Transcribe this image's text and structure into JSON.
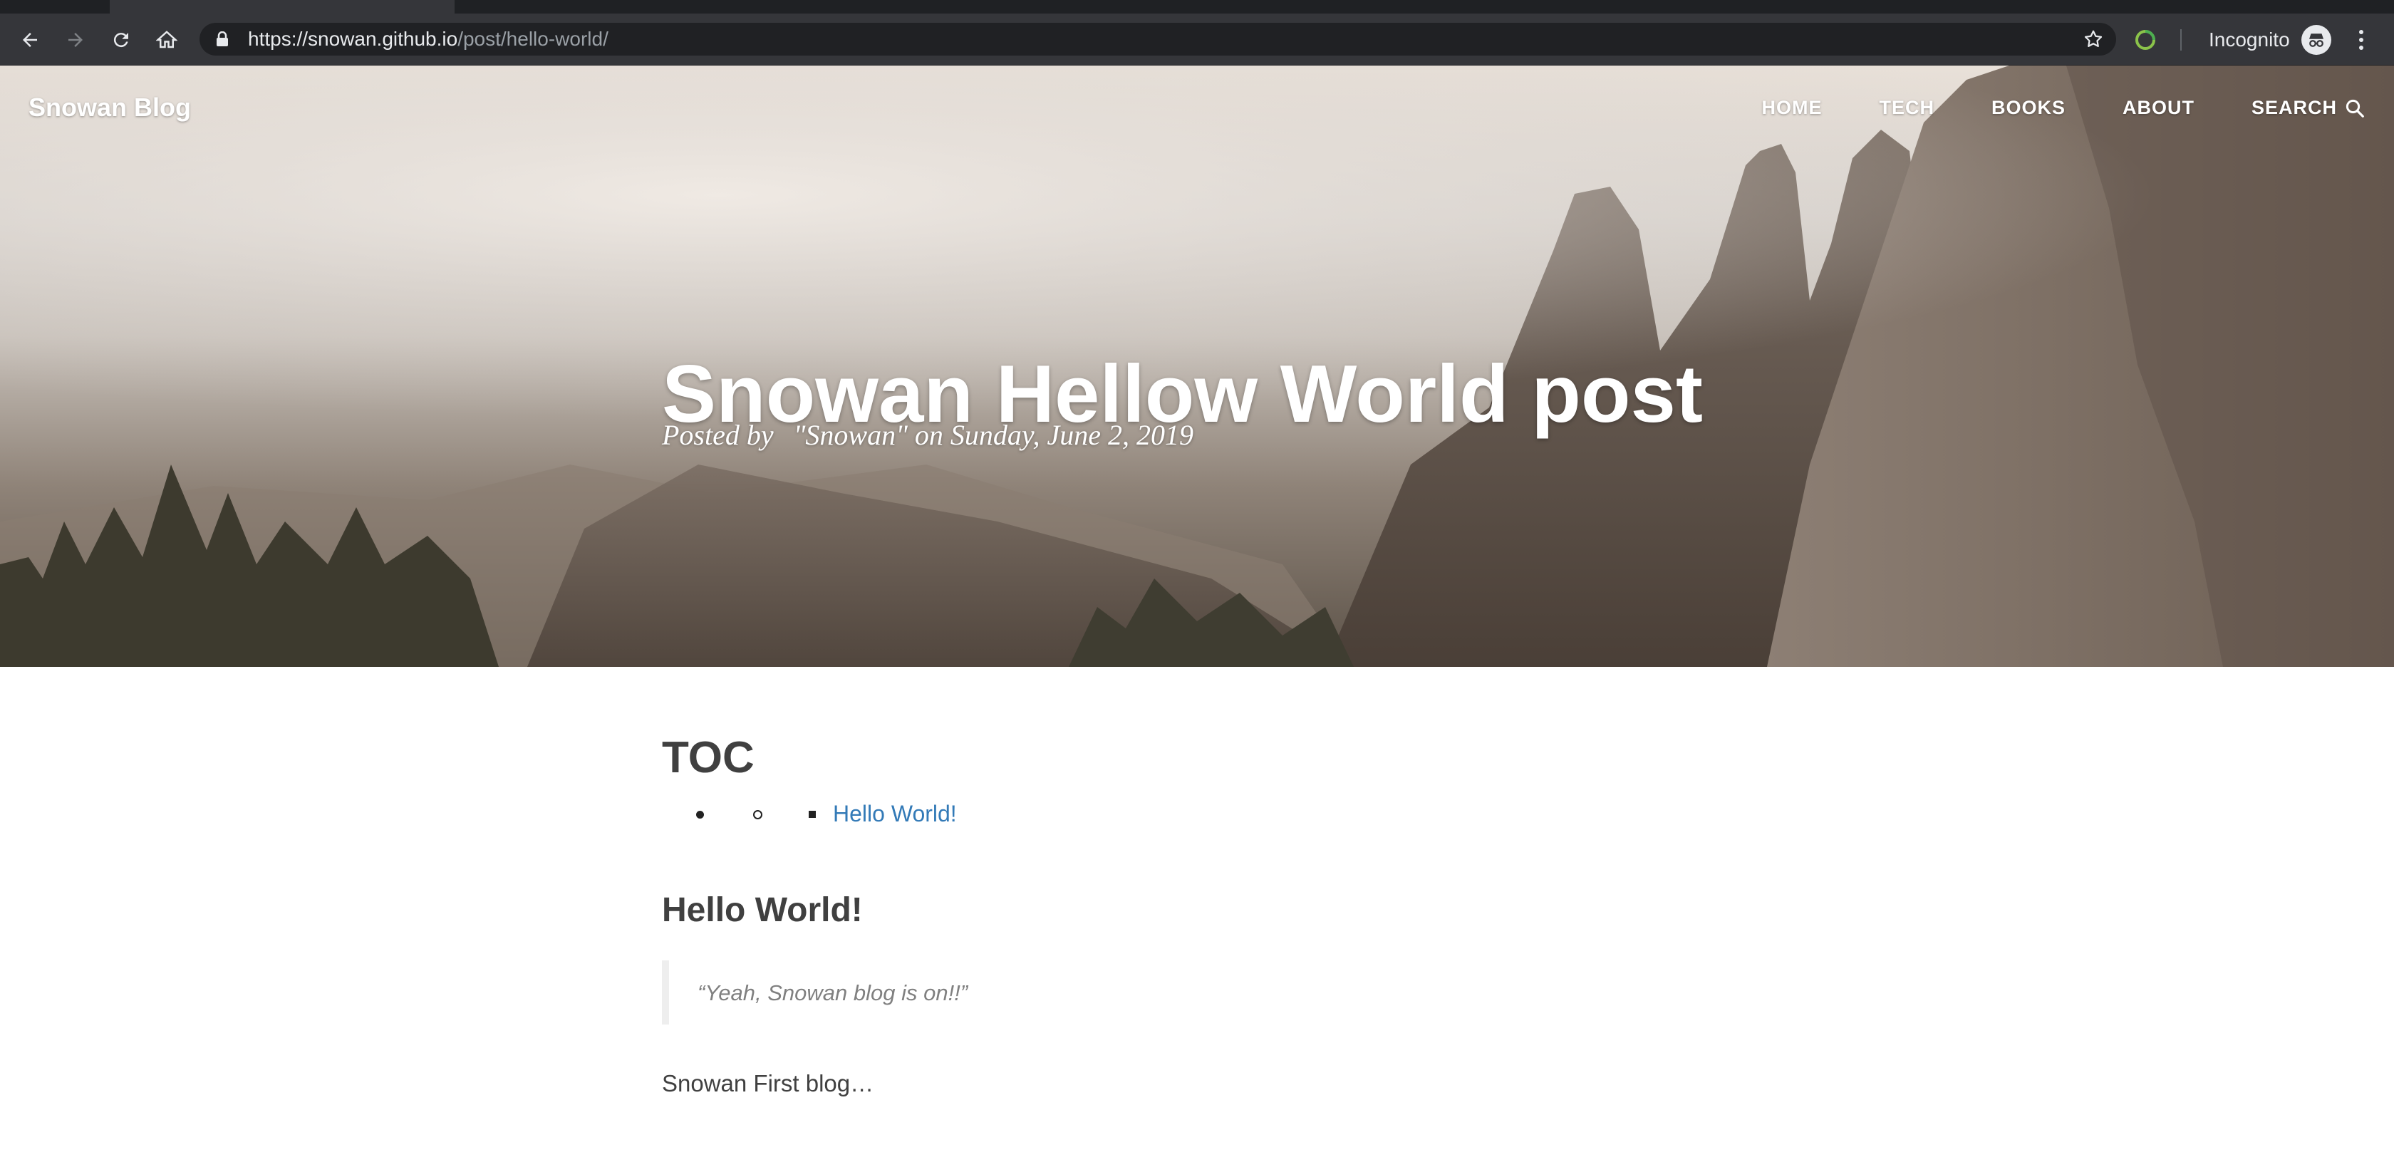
{
  "browser": {
    "url_host": "https://snowan.github.io",
    "url_path": "/post/hello-world/",
    "profile_label": "Incognito",
    "icons": [
      "back-arrow-icon",
      "forward-arrow-icon",
      "reload-icon",
      "home-icon",
      "lock-icon",
      "bookmark-star-icon",
      "extension-icon",
      "incognito-icon",
      "more-menu-icon"
    ]
  },
  "site": {
    "title": "Snowan Blog",
    "nav": [
      {
        "label": "HOME"
      },
      {
        "label": "TECH"
      },
      {
        "label": "BOOKS"
      },
      {
        "label": "ABOUT"
      },
      {
        "label": "SEARCH"
      }
    ]
  },
  "post": {
    "title": "Snowan Hellow World post",
    "meta_prefix": "Posted by",
    "author": "\"Snowan\"",
    "meta_date": "on Sunday, June 2, 2019"
  },
  "content": {
    "toc_heading": "TOC",
    "toc_link": "Hello World!",
    "section_heading": "Hello World!",
    "quote": "“Yeah, Snowan blog is on!!”",
    "paragraph": "Snowan First blog…"
  },
  "colors": {
    "chrome_bg": "#35363a",
    "omnibox_bg": "#202124",
    "link": "#337ab7",
    "body_text": "#404040",
    "quote_text": "#808080"
  }
}
